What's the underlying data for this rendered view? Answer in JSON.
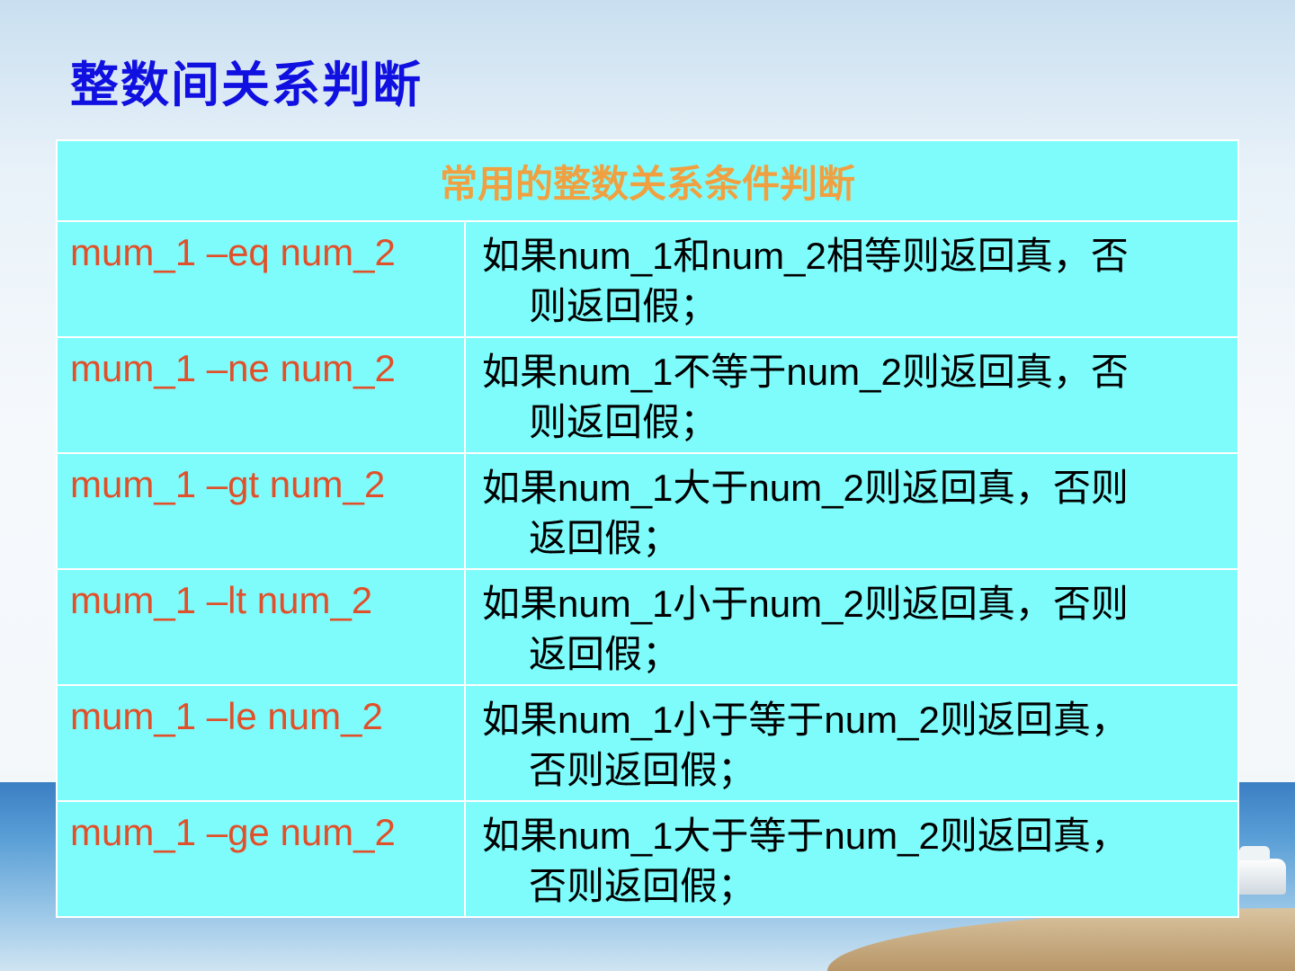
{
  "slide": {
    "title": "整数间关系判断"
  },
  "table": {
    "header": "常用的整数关系条件判断",
    "rows": [
      {
        "op": "mum_1 –eq num_2",
        "desc_line1": "如果num_1和num_2相等则返回真，否",
        "desc_line2": "则返回假；"
      },
      {
        "op": "mum_1 –ne num_2",
        "desc_line1": "如果num_1不等于num_2则返回真，否",
        "desc_line2": "则返回假；"
      },
      {
        "op": "mum_1 –gt num_2",
        "desc_line1": "如果num_1大于num_2则返回真，否则",
        "desc_line2": "返回假；"
      },
      {
        "op": "mum_1 –lt num_2",
        "desc_line1": "如果num_1小于num_2则返回真，否则",
        "desc_line2": "返回假；"
      },
      {
        "op": "mum_1 –le num_2",
        "desc_line1": "如果num_1小于等于num_2则返回真，",
        "desc_line2": "否则返回假；"
      },
      {
        "op": "mum_1 –ge num_2",
        "desc_line1": "如果num_1大于等于num_2则返回真，",
        "desc_line2": "否则返回假；"
      }
    ]
  },
  "colors": {
    "title": "#1010e0",
    "table_bg": "#7efcfc",
    "header_text": "#f0a040",
    "op_text": "#e0502a",
    "desc_text": "#000000"
  }
}
